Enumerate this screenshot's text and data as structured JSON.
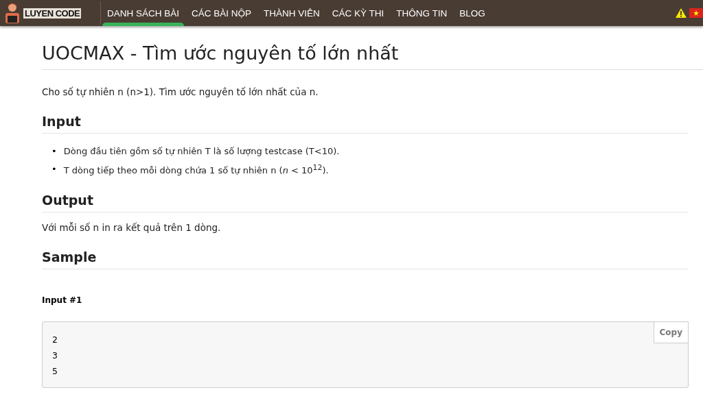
{
  "logo": {
    "text": "LUYEN CODE"
  },
  "nav": [
    {
      "label": "DANH SÁCH BÀI",
      "selected": true
    },
    {
      "label": "CÁC BÀI NỘP",
      "selected": false
    },
    {
      "label": "THÀNH VIÊN",
      "selected": false
    },
    {
      "label": "CÁC KỲ THI",
      "selected": false
    },
    {
      "label": "THÔNG TIN",
      "selected": false
    },
    {
      "label": "BLOG",
      "selected": false
    }
  ],
  "title": "UOCMAX - Tìm ước nguyên tố lớn nhất",
  "statement": "Cho số tự nhiên n (n>1). Tìm ước nguyên tố lớn nhất của n.",
  "sections": [
    {
      "heading": "Input",
      "kind": "list",
      "items": [
        {
          "bullet": "•",
          "text": "Dòng đầu tiên gồm số tự nhiên T là số lượng testcase (T<10)."
        },
        {
          "bullet": "•",
          "text": "T dòng tiếp theo mỗi dòng chứa 1 số tự nhiên n (*n* < 10$^{12}$)."
        }
      ]
    },
    {
      "heading": "Output",
      "kind": "text",
      "text": "Với mỗi số n in ra kết quả trên 1 dòng."
    },
    {
      "heading": "Sample",
      "kind": "sample",
      "label": "Input #1",
      "lines": [
        "2",
        "3",
        "5"
      ],
      "button": "Copy"
    }
  ]
}
